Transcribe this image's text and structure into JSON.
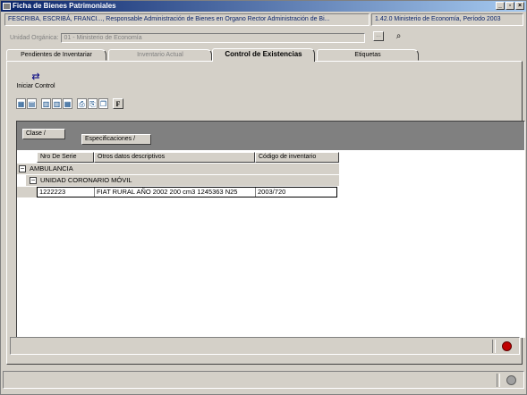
{
  "window": {
    "title": "Ficha de Bienes Patrimoniales",
    "min": "_",
    "max": "▫",
    "close": "×"
  },
  "infobar": {
    "user": "FESCRIBA, ESCRIBÁ, FRANCI..., Responsable Administración de Bienes en Organo Rector Administración de Bi...",
    "version": "1.42.0 Ministerio de Economía, Período 2003"
  },
  "unit": {
    "label": "Unidad Orgánica:",
    "value": "01 - Ministerio de Economía",
    "button": "..."
  },
  "tabs": [
    {
      "label": "Pendientes de Inventariar",
      "state": "normal"
    },
    {
      "label": "Inventario Actual",
      "state": "disabled"
    },
    {
      "label": "Control de Existencias",
      "state": "active"
    },
    {
      "label": "Etiquetas",
      "state": "normal"
    }
  ],
  "start_control": {
    "label": "Iniciar Control",
    "icon": "process-icon"
  },
  "toolbar": [
    {
      "icon": "grid-icon",
      "glyph": "▦"
    },
    {
      "icon": "export-icon",
      "glyph": "▤"
    },
    {
      "icon": "columns-icon",
      "glyph": "▥"
    },
    {
      "icon": "columns-alt-icon",
      "glyph": "▥"
    },
    {
      "icon": "table-icon",
      "glyph": "▦"
    },
    {
      "icon": "print-icon",
      "glyph": "⎙"
    },
    {
      "icon": "print-preview-icon",
      "glyph": "⎘"
    },
    {
      "icon": "copy-icon",
      "glyph": "❐"
    },
    {
      "icon": "font-icon",
      "glyph": "F"
    }
  ],
  "grid": {
    "group_chips": [
      "Clase /",
      "Especificaciones /"
    ],
    "columns": [
      "Nro De Serie",
      "Otros datos descriptivos",
      "Código de inventario"
    ],
    "group1": {
      "label": "AMBULANCIA",
      "toggle": "−"
    },
    "group2": {
      "label": "UNIDAD CORONARIO MÓVIL",
      "toggle": "−"
    },
    "row": {
      "serie": "1222223",
      "descripcion": "FIAT RURAL AÑO 2002 200 cm3 1245363 N25",
      "codigo": "2003/720"
    }
  },
  "colors": {
    "accent": "#0a246a",
    "record": "#c00000"
  }
}
